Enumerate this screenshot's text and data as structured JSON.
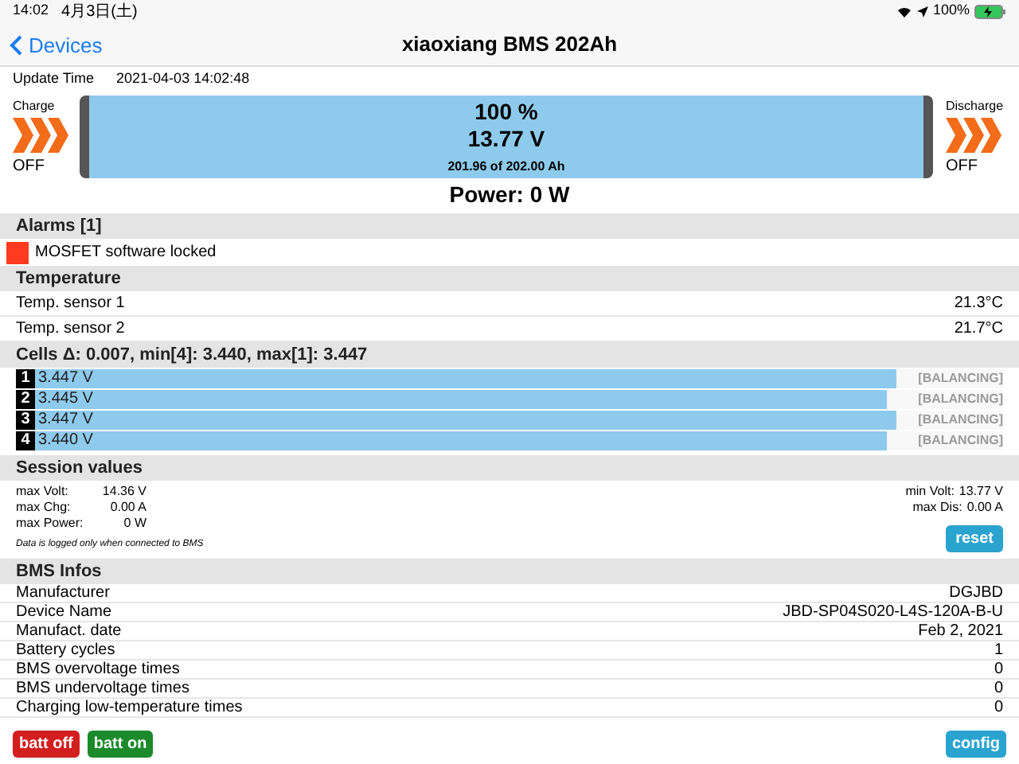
{
  "status_bar": {
    "time": "14:02",
    "date": "4月3日(土)",
    "battery": "100%"
  },
  "nav": {
    "back": "Devices",
    "title": "xiaoxiang BMS 202Ah"
  },
  "update": {
    "label": "Update Time",
    "value": "2021-04-03 14:02:48"
  },
  "charge": {
    "label": "Charge",
    "state": "OFF"
  },
  "discharge": {
    "label": "Discharge",
    "state": "OFF"
  },
  "battery": {
    "level": 1,
    "percent": "100 %",
    "voltage": "13.77 V",
    "capacity": "201.96 of 202.00 Ah"
  },
  "power": "Power: 0 W",
  "alarms": {
    "title": "Alarms [1]",
    "items": [
      {
        "text": "MOSFET software locked",
        "color": "#ff3b1f"
      }
    ]
  },
  "temperature": {
    "title": "Temperature",
    "rows": [
      {
        "label": "Temp. sensor 1",
        "value": "21.3°C"
      },
      {
        "label": "Temp. sensor 2",
        "value": "21.7°C"
      }
    ]
  },
  "cells": {
    "title": "Cells Δ: 0.007, min[4]: 3.440, max[1]: 3.447",
    "rows": [
      {
        "index": "1",
        "voltage": "3.447 V",
        "level": 0.89,
        "status": "[BALANCING]",
        "balancing": false
      },
      {
        "index": "2",
        "voltage": "3.445 V",
        "level": 0.88,
        "status": "[BALANCING]",
        "balancing": false
      },
      {
        "index": "3",
        "voltage": "3.447 V",
        "level": 0.89,
        "status": "[BALANCING]",
        "balancing": false
      },
      {
        "index": "4",
        "voltage": "3.440 V",
        "level": 0.88,
        "status": "[BALANCING]",
        "balancing": false
      }
    ]
  },
  "session": {
    "title": "Session values",
    "left": [
      {
        "label": "max Volt:",
        "value": "14.36 V"
      },
      {
        "label": "max Chg:",
        "value": "0.00 A"
      },
      {
        "label": "max Power:",
        "value": "0 W"
      }
    ],
    "right": [
      {
        "label": "min Volt:",
        "value": "13.77 V"
      },
      {
        "label": "max Dis:",
        "value": "0.00 A"
      }
    ],
    "note": "Data is logged only when connected to BMS",
    "reset": "reset"
  },
  "bms_infos": {
    "title": "BMS Infos",
    "rows": [
      {
        "label": "Manufacturer",
        "value": "DGJBD"
      },
      {
        "label": "Device Name",
        "value": "JBD-SP04S020-L4S-120A-B-U"
      },
      {
        "label": "Manufact. date",
        "value": "Feb 2, 2021"
      },
      {
        "label": "Battery cycles",
        "value": "1"
      },
      {
        "label": "BMS overvoltage times",
        "value": "0"
      },
      {
        "label": "BMS undervoltage times",
        "value": "0"
      },
      {
        "label": "Charging low-temperature times",
        "value": "0"
      }
    ]
  },
  "buttons": [
    {
      "label": "batt off",
      "kind": "off"
    },
    {
      "label": "batt on",
      "kind": "on"
    },
    {
      "label": "config",
      "kind": "config"
    }
  ]
}
